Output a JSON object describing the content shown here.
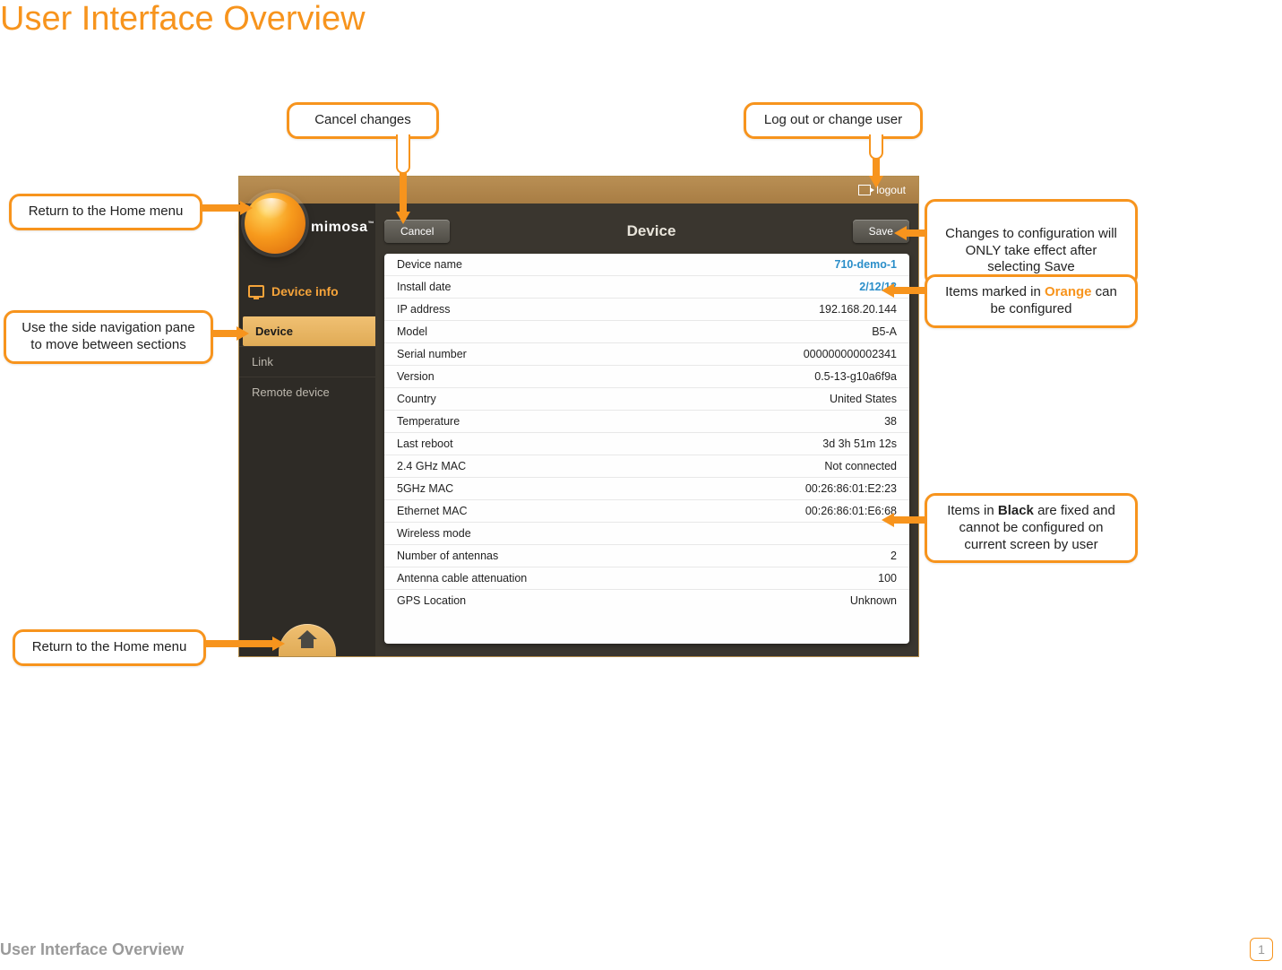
{
  "page": {
    "title": "User Interface Overview",
    "footer": "User Interface Overview",
    "page_number": "1"
  },
  "topbar": {
    "logout_label": "logout"
  },
  "logo": {
    "brand": "mimosa",
    "tm": "™"
  },
  "sidebar": {
    "section": "Device info",
    "items": [
      {
        "label": "Device",
        "active": true
      },
      {
        "label": "Link",
        "active": false
      },
      {
        "label": "Remote device",
        "active": false
      }
    ]
  },
  "panel": {
    "title": "Device",
    "cancel_label": "Cancel",
    "save_label": "Save",
    "rows": [
      {
        "label": "Device name",
        "value": "710-demo-1",
        "editable": true
      },
      {
        "label": "Install date",
        "value": "2/12/13",
        "editable": true
      },
      {
        "label": "IP address",
        "value": "192.168.20.144",
        "editable": false
      },
      {
        "label": "Model",
        "value": "B5-A",
        "editable": false
      },
      {
        "label": "Serial number",
        "value": "000000000002341",
        "editable": false
      },
      {
        "label": "Version",
        "value": "0.5-13-g10a6f9a",
        "editable": false
      },
      {
        "label": "Country",
        "value": "United States",
        "editable": false
      },
      {
        "label": "Temperature",
        "value": "38",
        "editable": false
      },
      {
        "label": "Last reboot",
        "value": "3d 3h 51m 12s",
        "editable": false
      },
      {
        "label": "2.4 GHz MAC",
        "value": "Not connected",
        "editable": false
      },
      {
        "label": "5GHz MAC",
        "value": "00:26:86:01:E2:23",
        "editable": false
      },
      {
        "label": "Ethernet MAC",
        "value": "00:26:86:01:E6:68",
        "editable": false
      },
      {
        "label": "Wireless mode",
        "value": "",
        "editable": false
      },
      {
        "label": "Number of antennas",
        "value": "2",
        "editable": false
      },
      {
        "label": "Antenna cable attenuation",
        "value": "100",
        "editable": false
      },
      {
        "label": "GPS Location",
        "value": "Unknown",
        "editable": false
      }
    ]
  },
  "callouts": {
    "cancel": "Cancel changes",
    "logout": "Log out or change user",
    "home_top": "Return to the Home menu",
    "sidenav": "Use the side navigation pane\nto move between sections",
    "home_bottom": "Return to the Home menu",
    "save_pre": "Changes to configuration will\nONLY take effect after\nselecting",
    "save_word": "Save",
    "orange_pre": "Items marked in ",
    "orange_word": "Orange",
    "orange_post": " can\nbe configured",
    "black_pre": "Items in ",
    "black_word": "Black",
    "black_post": " are fixed and\ncannot be configured on\ncurrent screen by user"
  }
}
